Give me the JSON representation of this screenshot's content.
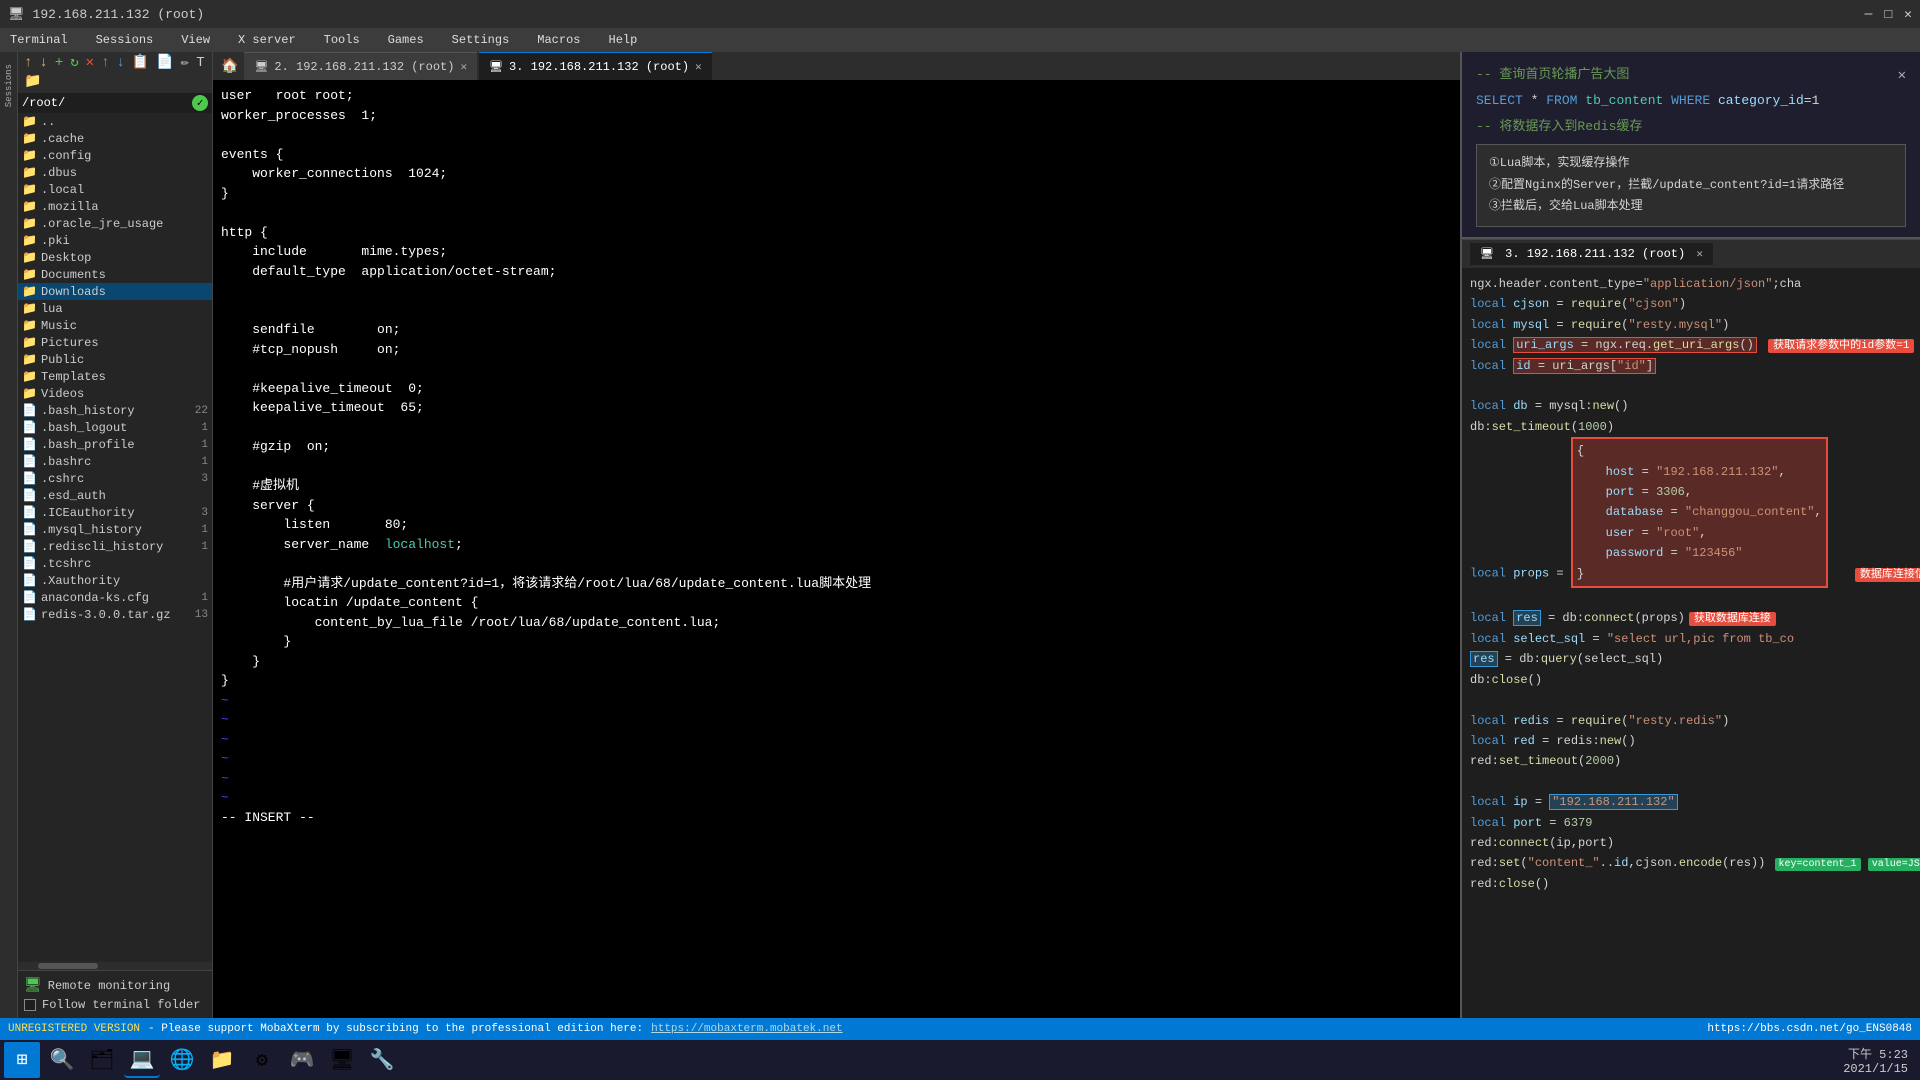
{
  "window": {
    "title": "192.168.211.132 (root)",
    "icon": "🖥"
  },
  "menu": {
    "items": [
      "Terminal",
      "Sessions",
      "View",
      "X server",
      "Tools",
      "Games",
      "Settings",
      "Macros",
      "Help"
    ]
  },
  "tabs": {
    "icon_btn": "🏠",
    "items": [
      {
        "id": 1,
        "label": "2. 192.168.211.132 (root)",
        "active": false
      },
      {
        "id": 2,
        "label": "3. 192.168.211.132 (root)",
        "active": true
      }
    ],
    "settings_icon": "⚙"
  },
  "sidebar": {
    "path": "/root/",
    "toolbar_icons": [
      "↑",
      "↓",
      "➕",
      "🔄",
      "🗑",
      "⬆",
      "⬇",
      "📋",
      "📄",
      "✏",
      "🔤",
      "📁"
    ],
    "files": [
      {
        "name": "..",
        "type": "folder",
        "count": ""
      },
      {
        "name": ".cache",
        "type": "folder",
        "count": ""
      },
      {
        "name": ".config",
        "type": "folder",
        "count": ""
      },
      {
        "name": ".dbus",
        "type": "folder",
        "count": ""
      },
      {
        "name": ".local",
        "type": "folder",
        "count": ""
      },
      {
        "name": ".mozilla",
        "type": "folder",
        "count": ""
      },
      {
        "name": ".oracle_jre_usage",
        "type": "folder",
        "count": ""
      },
      {
        "name": ".pki",
        "type": "folder",
        "count": ""
      },
      {
        "name": "Desktop",
        "type": "folder",
        "count": ""
      },
      {
        "name": "Documents",
        "type": "folder",
        "count": ""
      },
      {
        "name": "Downloads",
        "type": "folder",
        "count": "",
        "selected": true
      },
      {
        "name": "lua",
        "type": "folder",
        "count": ""
      },
      {
        "name": "Music",
        "type": "folder",
        "count": ""
      },
      {
        "name": "Pictures",
        "type": "folder",
        "count": ""
      },
      {
        "name": "Public",
        "type": "folder",
        "count": ""
      },
      {
        "name": "Templates",
        "type": "folder",
        "count": ""
      },
      {
        "name": "Videos",
        "type": "folder",
        "count": ""
      },
      {
        "name": ".bash_history",
        "type": "file",
        "count": "22"
      },
      {
        "name": ".bash_logout",
        "type": "file",
        "count": "1"
      },
      {
        "name": ".bash_profile",
        "type": "file",
        "count": "1"
      },
      {
        "name": ".bashrc",
        "type": "file",
        "count": "1"
      },
      {
        "name": ".cshrc",
        "type": "file",
        "count": "3"
      },
      {
        "name": ".esd_auth",
        "type": "file",
        "count": ""
      },
      {
        "name": ".ICEauthority",
        "type": "file",
        "count": "3"
      },
      {
        "name": ".mysql_history",
        "type": "file",
        "count": "1"
      },
      {
        "name": ".rediscli_history",
        "type": "file",
        "count": "1"
      },
      {
        "name": ".tcshrc",
        "type": "file",
        "count": ""
      },
      {
        "name": ".Xauthority",
        "type": "file",
        "count": ""
      },
      {
        "name": "anaconda-ks.cfg",
        "type": "file",
        "count": "1"
      },
      {
        "name": "redis-3.0.0.tar.gz",
        "type": "file",
        "count": "13"
      }
    ],
    "remote_monitoring": "Remote monitoring",
    "follow_terminal_folder": "Follow terminal folder"
  },
  "terminal": {
    "content_lines": [
      "user   root root;",
      "worker_processes  1;",
      "",
      "events {",
      "    worker_connections  1024;",
      "}",
      "",
      "http {",
      "    include       mime.types;",
      "    default_type  application/octet-stream;",
      "",
      "",
      "    sendfile        on;",
      "    #tcp_nopush     on;",
      "",
      "    #keepalive_timeout  0;",
      "    keepalive_timeout  65;",
      "",
      "    #gzip  on;",
      "",
      "    #虚拟机",
      "    server {",
      "        listen       80;",
      "        server_name  localhost;",
      "",
      "        #用户请求/update_content?id=1，将该请求给/root/lua/68/update_content.lua脚本处理",
      "        locatin /update_content {",
      "            content_by_lua_file /root/lua/68/update_content.lua;",
      "        }",
      "    }",
      "}"
    ],
    "cursor_line": "-- INSERT --",
    "mode": "INSERT"
  },
  "sql_panel": {
    "close_btn": "✕",
    "comment1": "-- 查询首页轮播广告大图",
    "line1": "SELECT * FROM tb_content WHERE category_id=1",
    "comment2": "-- 将数据存入到Redis缓存",
    "info_items": [
      "①Lua脚本，实现缓存操作",
      "②配置Nginx的Server，拦截/update_content?id=1请求路径",
      "③拦截后，交给Lua脚本处理"
    ]
  },
  "lua_panel": {
    "tabs": [
      {
        "label": "3. 192.168.211.132 (root)",
        "active": true
      }
    ],
    "close_btn": "✕",
    "code_lines": [
      "ngx.header.content_type=\"application/json\";cha",
      "local cjson = require(\"cjson\")",
      "local mysql = require(\"resty.mysql\")",
      "local uri_args = ngx.req.get_uri_args()",
      "local id = uri_args[\"id\"]",
      "",
      "local db = mysql:new()",
      "db:set_timeout(1000)",
      "local props = {",
      "    host = \"192.168.211.132\",",
      "    port = 3306,",
      "    database = \"changgou_content\",",
      "    user = \"root\",",
      "    password = \"123456\"",
      "}",
      "",
      "local res = db:connect(props)",
      "local select_sql = \"select url,pic from tb_co",
      "res = db:query(select_sql)",
      "db:close()",
      "",
      "local redis = require(\"resty.redis\")",
      "local red = redis:new()",
      "red:set_timeout(2000)",
      "",
      "local ip = \"192.168.211.132\"",
      "local port = 6379",
      "red:connect(ip,port)",
      "red:set(\"content_\"..id,cjson.encode(res))",
      "red:close()"
    ],
    "annotations": {
      "uri_args": "获取请求参数中的id参数=1",
      "db_connect": "获取数据库连接",
      "db_box_label": "数据库连接信息",
      "res_connect": "获取数据库连接",
      "key_label": "key=content_1",
      "value_label": "value=JSON(res)"
    }
  },
  "status_bar": {
    "warning_text": "UNREGISTERED VERSION",
    "message": "Please support MobaXterm by subscribing to the professional edition here:",
    "link": "https://mobaxterm.mobatek.net",
    "right_text": "https://bbs.csdn.net/go_ENS0848"
  },
  "taskbar": {
    "start_icon": "⊞",
    "icons": [
      "🔍",
      "🗂",
      "💻",
      "🌐",
      "📁",
      "⚙",
      "🎮",
      "🖥",
      "🔧"
    ],
    "time": "下午 5:23",
    "date": "2021/1/15"
  }
}
